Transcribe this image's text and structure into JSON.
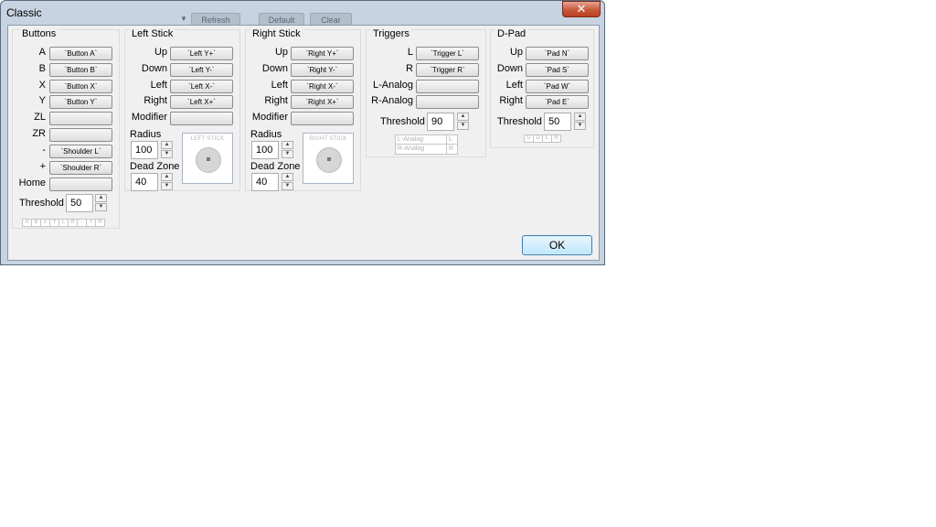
{
  "window": {
    "title": "Classic",
    "close_glyph": "✕",
    "background_buttons": [
      "Refresh",
      "Default",
      "Clear"
    ],
    "ok_label": "OK"
  },
  "buttons": {
    "title": "Buttons",
    "rows": [
      {
        "label": "A",
        "value": "`Button A`"
      },
      {
        "label": "B",
        "value": "`Button B`"
      },
      {
        "label": "X",
        "value": "`Button X`"
      },
      {
        "label": "Y",
        "value": "`Button Y`"
      },
      {
        "label": "ZL",
        "value": ""
      },
      {
        "label": "ZR",
        "value": ""
      },
      {
        "label": "-",
        "value": "`Shoulder L`"
      },
      {
        "label": "+",
        "value": "`Shoulder R`"
      },
      {
        "label": "Home",
        "value": ""
      }
    ],
    "threshold_label": "Threshold",
    "threshold_value": "50",
    "indicator": [
      "A",
      "B",
      "X",
      "Y",
      "L",
      "R",
      "-",
      "+",
      "H"
    ]
  },
  "left_stick": {
    "title": "Left Stick",
    "rows": [
      {
        "label": "Up",
        "value": "`Left Y+`"
      },
      {
        "label": "Down",
        "value": "`Left Y-`"
      },
      {
        "label": "Left",
        "value": "`Left X-`"
      },
      {
        "label": "Right",
        "value": "`Left X+`"
      },
      {
        "label": "Modifier",
        "value": ""
      }
    ],
    "radius_label": "Radius",
    "radius_value": "100",
    "deadzone_label": "Dead Zone",
    "deadzone_value": "40",
    "preview_label": "LEFT STICK"
  },
  "right_stick": {
    "title": "Right Stick",
    "rows": [
      {
        "label": "Up",
        "value": "`Right Y+`"
      },
      {
        "label": "Down",
        "value": "`Right Y-`"
      },
      {
        "label": "Left",
        "value": "`Right X-`"
      },
      {
        "label": "Right",
        "value": "`Right X+`"
      },
      {
        "label": "Modifier",
        "value": ""
      }
    ],
    "radius_label": "Radius",
    "radius_value": "100",
    "deadzone_label": "Dead Zone",
    "deadzone_value": "40",
    "preview_label": "RIGHT STICK"
  },
  "triggers": {
    "title": "Triggers",
    "rows": [
      {
        "label": "L",
        "value": "`Trigger L`"
      },
      {
        "label": "R",
        "value": "`Trigger R`"
      },
      {
        "label": "L-Analog",
        "value": ""
      },
      {
        "label": "R-Analog",
        "value": ""
      }
    ],
    "threshold_label": "Threshold",
    "threshold_value": "90",
    "analog_rows": [
      {
        "name": "L-Analog",
        "key": "L"
      },
      {
        "name": "R-Analog",
        "key": "R"
      }
    ]
  },
  "dpad": {
    "title": "D-Pad",
    "rows": [
      {
        "label": "Up",
        "value": "`Pad N`"
      },
      {
        "label": "Down",
        "value": "`Pad S`"
      },
      {
        "label": "Left",
        "value": "`Pad W`"
      },
      {
        "label": "Right",
        "value": "`Pad E`"
      }
    ],
    "threshold_label": "Threshold",
    "threshold_value": "50",
    "indicator": [
      "U",
      "D",
      "L",
      "R"
    ]
  },
  "spinner_glyphs": {
    "up": "▲",
    "down": "▼"
  }
}
